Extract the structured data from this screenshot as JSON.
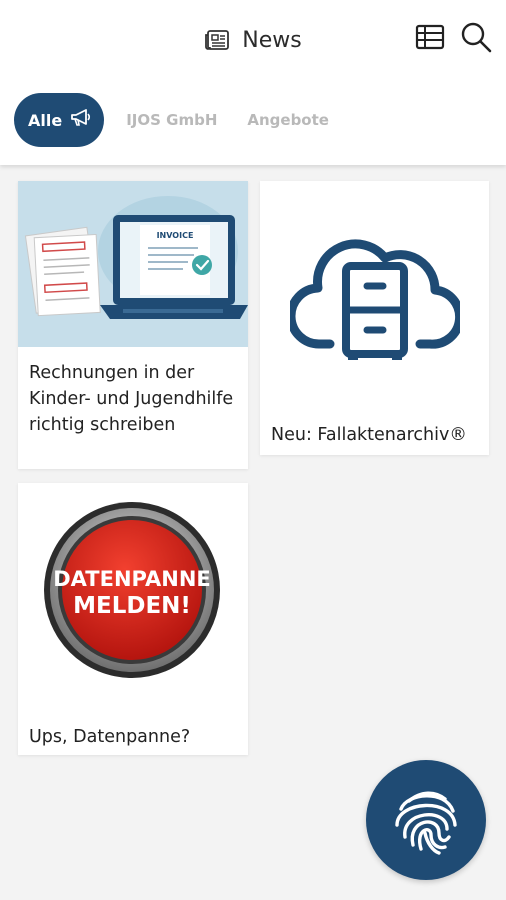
{
  "header": {
    "title": "News",
    "title_icon": "newspaper-icon",
    "actions": [
      {
        "icon": "table-icon"
      },
      {
        "icon": "search-icon"
      }
    ]
  },
  "tabs": [
    {
      "label": "Alle",
      "icon": "megaphone-icon",
      "active": true
    },
    {
      "label": "IJOS GmbH",
      "active": false
    },
    {
      "label": "Angebote",
      "active": false
    }
  ],
  "cards": [
    {
      "text": "Rechnungen in der Kinder- und Jugendhilfe richtig schreiben",
      "image": "invoice-laptop-illustration",
      "image_label": "INVOICE"
    },
    {
      "text": "Neu: Fallaktenarchiv®",
      "image": "cloud-cabinet-icon"
    },
    {
      "text": "Ups, Datenpanne?",
      "image": "red-button-illustration",
      "image_line1": "DATENPANNE",
      "image_line2": "MELDEN!"
    }
  ],
  "fab": {
    "icon": "fingerprint-icon"
  },
  "colors": {
    "primary": "#1f4b74",
    "tab_inactive": "#b9b9b9",
    "background": "#f3f3f3",
    "alert_red": "#d8261c"
  }
}
